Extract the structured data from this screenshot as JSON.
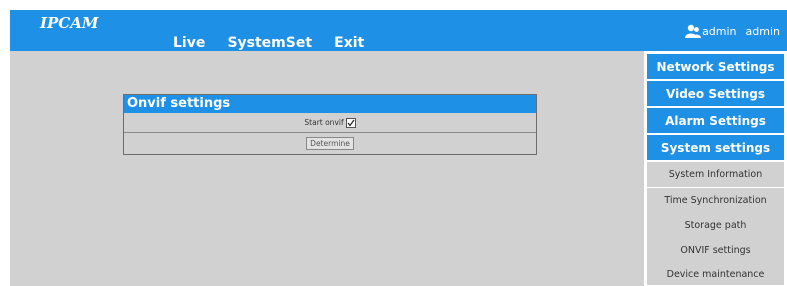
{
  "header": {
    "logo": "IPCAM",
    "nav": [
      "Live",
      "SystemSet",
      "Exit"
    ],
    "user_icon": "user-icon",
    "user_label": "admin",
    "user_name": "admin"
  },
  "sidebar": {
    "items": [
      {
        "label": "Network Settings"
      },
      {
        "label": "Video Settings"
      },
      {
        "label": "Alarm Settings"
      },
      {
        "label": "System settings"
      },
      {
        "label": "System Information"
      },
      {
        "label": "Time Synchronization"
      },
      {
        "label": "Storage path"
      },
      {
        "label": "ONVIF settings"
      },
      {
        "label": "Device maintenance"
      }
    ]
  },
  "panel": {
    "title": "Onvif settings",
    "start_label": "Start onvif",
    "start_checked": true,
    "button_label": "Determine"
  },
  "colors": {
    "accent": "#1e90e6",
    "content_bg": "#d1d1d1"
  }
}
